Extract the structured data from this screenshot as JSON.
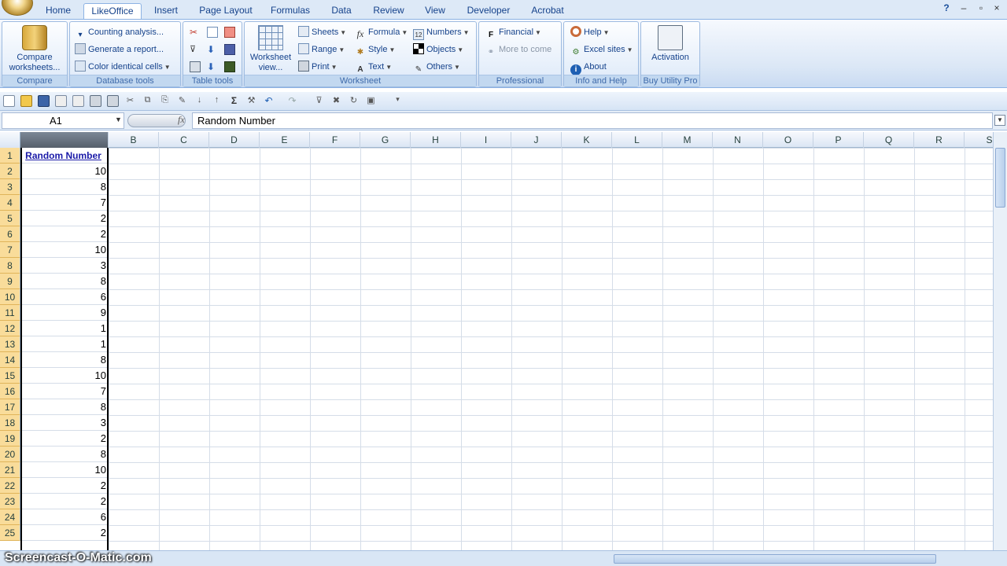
{
  "tabs": [
    "Home",
    "LikeOffice",
    "Insert",
    "Page Layout",
    "Formulas",
    "Data",
    "Review",
    "View",
    "Developer",
    "Acrobat"
  ],
  "active_tab": "LikeOffice",
  "ribbon": {
    "compare": {
      "button": "Compare worksheets...",
      "label": "Compare"
    },
    "database": {
      "items": [
        "Counting analysis...",
        "Generate a report...",
        "Color identical cells"
      ],
      "label": "Database tools"
    },
    "table_tools": {
      "label": "Table tools"
    },
    "worksheet": {
      "big_button": "Worksheet view...",
      "col1": [
        "Sheets",
        "Range",
        "Print"
      ],
      "col2": [
        "Formula",
        "Style",
        "Text"
      ],
      "col3": [
        "Numbers",
        "Objects",
        "Others"
      ],
      "label": "Worksheet"
    },
    "professional": {
      "items": [
        "Financial",
        "More to come"
      ],
      "label": "Professional"
    },
    "info": {
      "items": [
        "Help",
        "Excel sites",
        "About"
      ],
      "label": "Info and Help"
    },
    "buy": {
      "button": "Activation",
      "label": "Buy Utility Pro"
    }
  },
  "formula_bar": {
    "name_box": "A1",
    "formula": "Random Number"
  },
  "columns": [
    "B",
    "C",
    "D",
    "E",
    "F",
    "G",
    "H",
    "I",
    "J",
    "K",
    "L",
    "M",
    "N",
    "O",
    "P",
    "Q",
    "R",
    "S"
  ],
  "rows": [
    "1",
    "2",
    "3",
    "4",
    "5",
    "6",
    "7",
    "8",
    "9",
    "10",
    "11",
    "12",
    "13",
    "14",
    "15",
    "16",
    "17",
    "18",
    "19",
    "20",
    "21",
    "22",
    "23",
    "24",
    "25"
  ],
  "column_a": [
    "Random Number",
    "10",
    "8",
    "7",
    "2",
    "2",
    "10",
    "3",
    "8",
    "6",
    "9",
    "1",
    "1",
    "8",
    "10",
    "7",
    "8",
    "3",
    "2",
    "8",
    "10",
    "2",
    "2",
    "6",
    "2"
  ],
  "watermark": "Screencast-O-Matic.com"
}
